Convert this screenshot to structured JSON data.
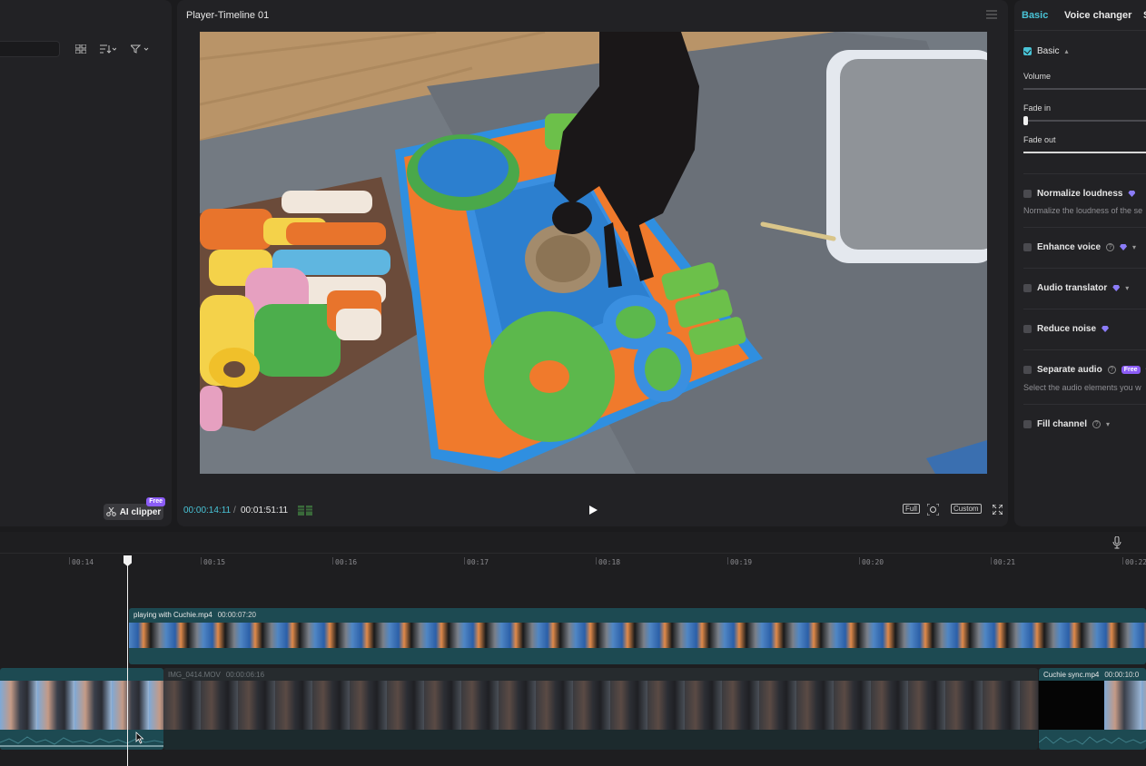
{
  "left_panel": {
    "ai_clipper_label": "AI clipper",
    "ai_clipper_badge": "Free"
  },
  "player": {
    "title": "Player-Timeline 01",
    "current_time": "00:00:14:11",
    "separator": "/",
    "total_time": "00:01:51:11",
    "full_label": "Full",
    "custom_label": "Custom"
  },
  "inspector": {
    "tabs": [
      "Basic",
      "Voice changer",
      "S"
    ],
    "basic_section": "Basic",
    "volume_label": "Volume",
    "fade_in_label": "Fade in",
    "fade_out_label": "Fade out",
    "normalize_label": "Normalize loudness",
    "normalize_desc": "Normalize the loudness of the se",
    "enhance_label": "Enhance voice",
    "translator_label": "Audio translator",
    "noise_label": "Reduce noise",
    "separate_label": "Separate audio",
    "separate_badge": "Free",
    "separate_desc": "Select the audio elements you w",
    "fill_label": "Fill channel",
    "fade_in_level": 0.0,
    "fade_out_level": 1.0
  },
  "timeline": {
    "ruler": [
      "00:14",
      "00:15",
      "00:16",
      "00:17",
      "00:18",
      "00:19",
      "00:20",
      "00:21",
      "00:22"
    ],
    "clip1": {
      "name": "playing with Cuchie.mp4",
      "duration": "00:00:07:20"
    },
    "clip2": {
      "name": "IMG_0414.MOV",
      "duration": "00:00:06:16"
    },
    "clip3": {
      "name": "Cuchie sync.mp4",
      "duration": "00:00:10:0"
    }
  },
  "colors": {
    "accent": "#49c3d6",
    "premium": "#8b5cf6",
    "clip_teal": "#1d4a52"
  }
}
